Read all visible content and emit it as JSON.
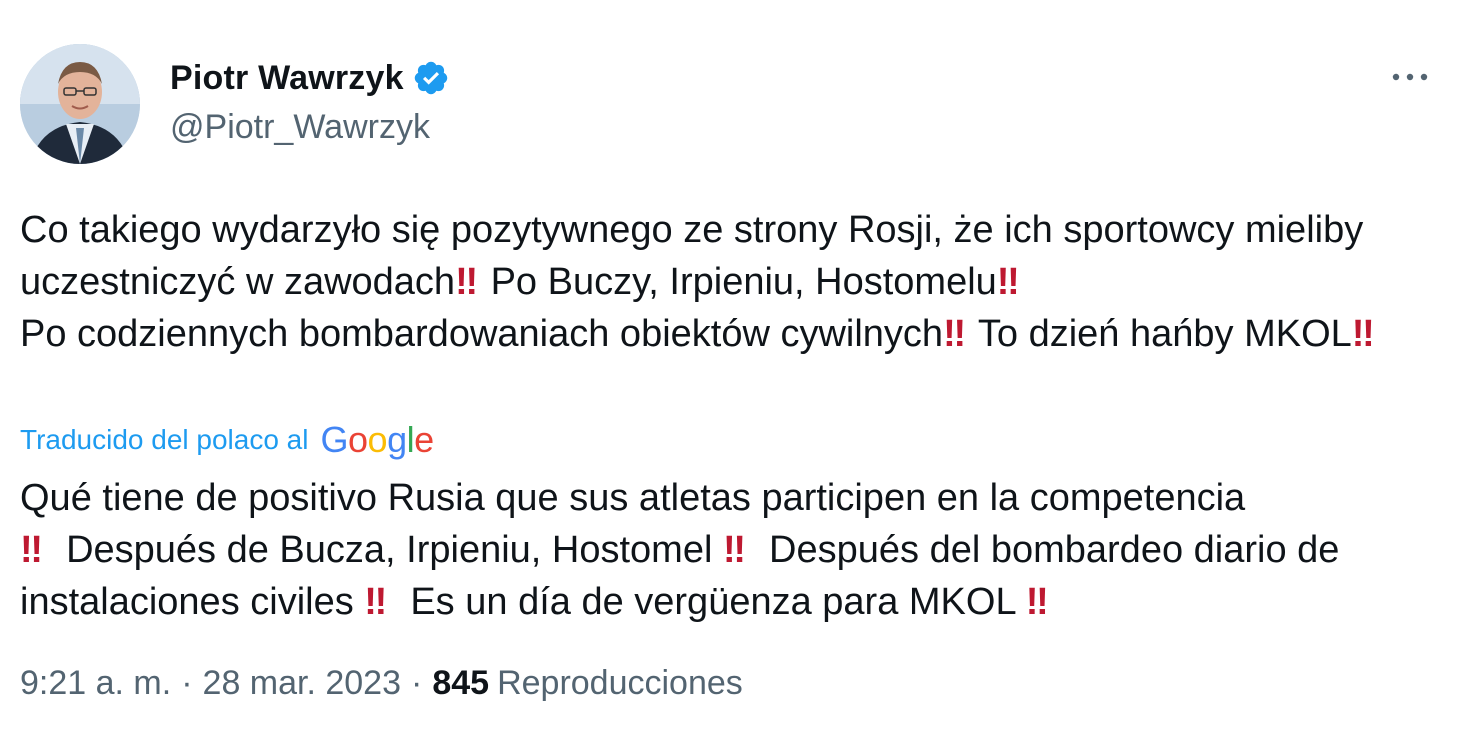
{
  "author": {
    "display_name": "Piotr Wawrzyk",
    "handle": "@Piotr_Wawrzyk",
    "verified": true
  },
  "tweet": {
    "text_segments": [
      "Co takiego wydarzyło się pozytywnego ze strony Rosji, że ich sportowcy mieliby uczestniczyć w zawodach",
      "‼",
      " Po Buczy, Irpieniu, Hostomelu",
      "‼",
      "\nPo codziennych bombardowaniach obiektów cywilnych",
      "‼",
      " To dzień hańby MKOL",
      "‼"
    ],
    "translation_label": "Traducido del polaco al",
    "translation_provider": "Google",
    "translated_segments": [
      "Qué tiene de positivo Rusia que sus atletas participen en la competencia\n",
      "‼",
      "  Después de Bucza, Irpieniu, Hostomel ",
      "‼",
      "  Después del bombardeo diario de instalaciones civiles ",
      "‼",
      "  Es un día de vergüenza para MKOL ",
      "‼"
    ]
  },
  "meta": {
    "time": "9:21 a. m.",
    "separator": "·",
    "date": "28 mar. 2023",
    "views_count": "845",
    "views_label": "Reproducciones"
  },
  "colors": {
    "text": "#0f1419",
    "secondary": "#536471",
    "link": "#1d9bf0",
    "verified": "#1d9bf0",
    "bang": "#be1931"
  },
  "icons": {
    "verified": "verified-badge-icon",
    "more": "more-horizontal-icon"
  }
}
